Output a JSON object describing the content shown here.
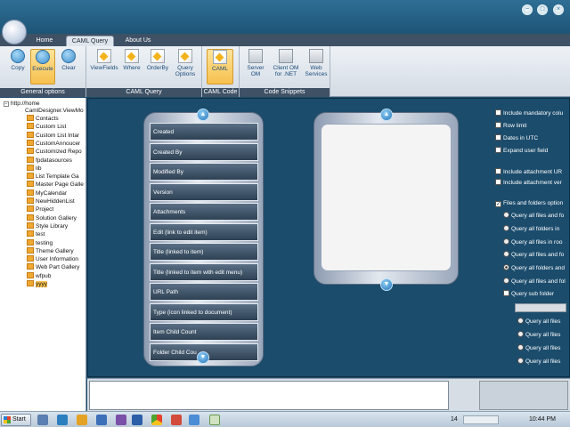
{
  "tabs": [
    "Home",
    "CAML Query",
    "About Us"
  ],
  "ribbon": {
    "general": {
      "label": "General options",
      "buttons": [
        "Copy",
        "Execute",
        "Clear"
      ]
    },
    "caml_query": {
      "label": "CAML Query",
      "buttons": [
        "ViewFields",
        "Where",
        "OrderBy",
        "Query Options"
      ]
    },
    "caml_code": {
      "label": "CAML Code",
      "buttons": [
        "CAML"
      ]
    },
    "snippets": {
      "label": "Code Snippets",
      "buttons": [
        "Server OM",
        "Client OM for .NET",
        "Web Services"
      ]
    }
  },
  "tree": {
    "root": "http://home",
    "site": "CamlDesigner.ViewMo",
    "items": [
      "Contacts",
      "Custom List",
      "Custom List Intar",
      "CustomAnnoucer",
      "Customized Repo",
      "fpdatasources",
      "lib",
      "List Template Ga",
      "Master Page Galle",
      "MyCalendar",
      "NewHiddenList",
      "Project",
      "Solution Gallery",
      "Style Library",
      "test",
      "testing",
      "Theme Gallery",
      "User Information",
      "Web Part Gallery",
      "wfpub",
      "yyyy"
    ]
  },
  "fields": [
    "Created",
    "Created By",
    "Modified By",
    "Version",
    "Attachments",
    "Edit (link to edit item)",
    "Title (linked to item)",
    "Title (linked to item with edit menu)",
    "URL Path",
    "Type (icon linked to document)",
    "Item Child Count",
    "Folder Child Cou"
  ],
  "options": {
    "checks": [
      "Include mandatory colu",
      "Row limit",
      "Dates in UTC",
      "Expand user field"
    ],
    "attach": [
      "Include attachment UR",
      "Include attachment ver"
    ],
    "files_folders": "Files and folders option",
    "radios": [
      "Query all files and fo",
      "Query all folders in",
      "Query all files in roo",
      "Query all files and fo",
      "Query all folders and",
      "Query all files and fol"
    ],
    "sub_folder": "Query sub folder",
    "sub_radios": [
      "Query all files",
      "Query all files",
      "Query all files",
      "Query all files"
    ]
  },
  "taskbar": {
    "start": "Start",
    "badge": "14",
    "time": "10:44 PM"
  }
}
